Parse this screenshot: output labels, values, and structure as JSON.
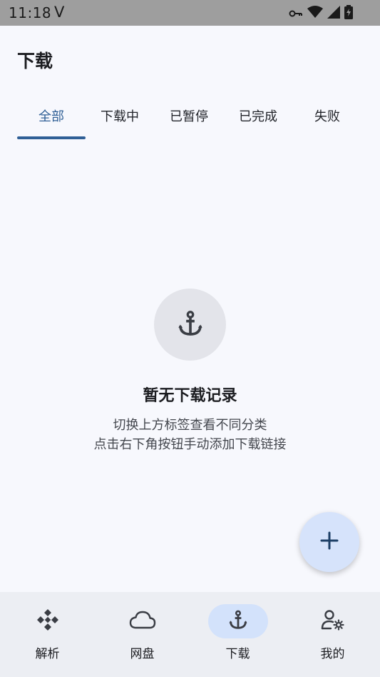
{
  "status_bar": {
    "time": "11:18",
    "carrier": "V"
  },
  "header": {
    "title": "下载"
  },
  "tabs": [
    {
      "label": "全部",
      "active": true
    },
    {
      "label": "下载中"
    },
    {
      "label": "已暂停"
    },
    {
      "label": "已完成"
    },
    {
      "label": "失败"
    }
  ],
  "empty_state": {
    "icon": "anchor-icon",
    "title": "暂无下载记录",
    "line1": "切换上方标签查看不同分类",
    "line2": "点击右下角按钮手动添加下载链接"
  },
  "fab": {
    "icon": "plus-icon"
  },
  "bottom_nav": [
    {
      "label": "解析",
      "icon": "parse-icon"
    },
    {
      "label": "网盘",
      "icon": "cloud-icon"
    },
    {
      "label": "下载",
      "icon": "anchor-icon",
      "active": true
    },
    {
      "label": "我的",
      "icon": "user-settings-icon"
    }
  ],
  "colors": {
    "accent": "#2f5f96",
    "background": "#f7f8fd",
    "nav_active": "#d3e2fb",
    "fab": "#d6e3fb"
  }
}
